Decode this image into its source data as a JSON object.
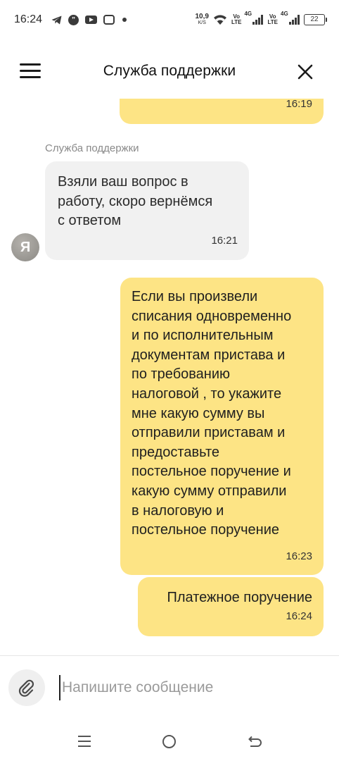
{
  "status_bar": {
    "time": "16:24",
    "net_speed": "10,9",
    "net_speed_unit": "K/S",
    "vo_lte_1_top": "Vo",
    "vo_lte_1_bottom": "LTE",
    "net_type_1": "4G",
    "vo_lte_2_top": "Vo",
    "vo_lte_2_bottom": "LTE",
    "net_type_2": "4G",
    "battery": "22"
  },
  "header": {
    "title": "Служба поддержки"
  },
  "chat": {
    "messages": [
      {
        "from": "user",
        "text": "",
        "time": "16:19"
      },
      {
        "from": "support",
        "sender": "Служба поддержки",
        "text": "Взяли ваш вопрос в\nработу, скоро вернёмся\nс ответом",
        "time": "16:21",
        "avatar_letter": "Я"
      },
      {
        "from": "user",
        "text": "Если вы произвели\nсписания одновременно\nи по исполнительным\nдокументам пристава и\nпо требованию\nналоговой , то укажите\nмне какую сумму вы\nотправили приставам и\nпредоставьте\nпостельное поручение и\nкакую сумму отправили\nв налоговую и\nпостельное поручение",
        "time": "16:23"
      },
      {
        "from": "user",
        "text": "Платежное поручение",
        "time": "16:24"
      }
    ]
  },
  "composer": {
    "placeholder": "Напишите сообщение",
    "value": ""
  },
  "colors": {
    "outgoing_bubble": "#fde485",
    "incoming_bubble": "#f1f1f1"
  }
}
